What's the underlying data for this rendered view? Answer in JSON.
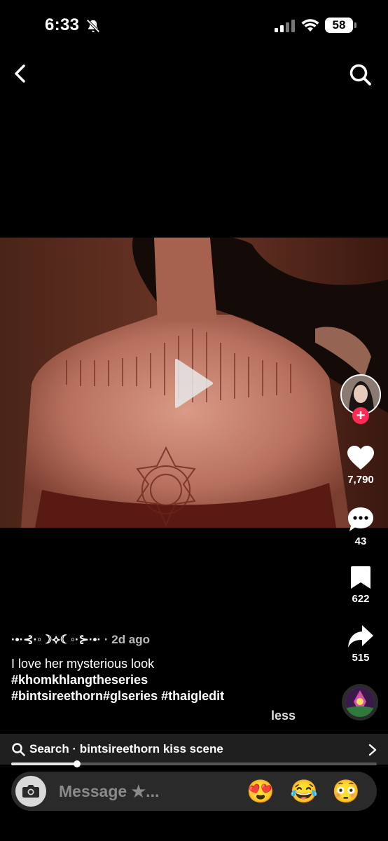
{
  "status_bar": {
    "time": "6:33",
    "battery": "58",
    "icons": [
      "bell-slash-icon",
      "cellular-signal-icon",
      "wifi-icon",
      "battery-icon"
    ]
  },
  "nav": {
    "icons": [
      "back-arrow-icon",
      "search-icon"
    ]
  },
  "video": {
    "play_icon": "play-icon"
  },
  "rail": {
    "likes": "7,790",
    "comments": "43",
    "bookmarks": "622",
    "shares": "515",
    "follow_symbol": "+"
  },
  "caption": {
    "username": "·•·⊰·◦☽⟡☾◦·⊱·•·",
    "ago": " · 2d ago",
    "line1": "I love her mysterious look",
    "tag1": "#khomkhlangtheseries",
    "tag2": "#bintsireethorn#glseries #thaigledit",
    "less": "less"
  },
  "search_strip": {
    "text": "Search · bintsireethorn kiss scene"
  },
  "progress": {
    "fraction": 0.18
  },
  "message": {
    "placeholder": "Message ★...",
    "emojis": [
      "😍",
      "😂",
      "😳"
    ]
  },
  "colors": {
    "accent": "#fe2c55",
    "background": "#000000"
  }
}
